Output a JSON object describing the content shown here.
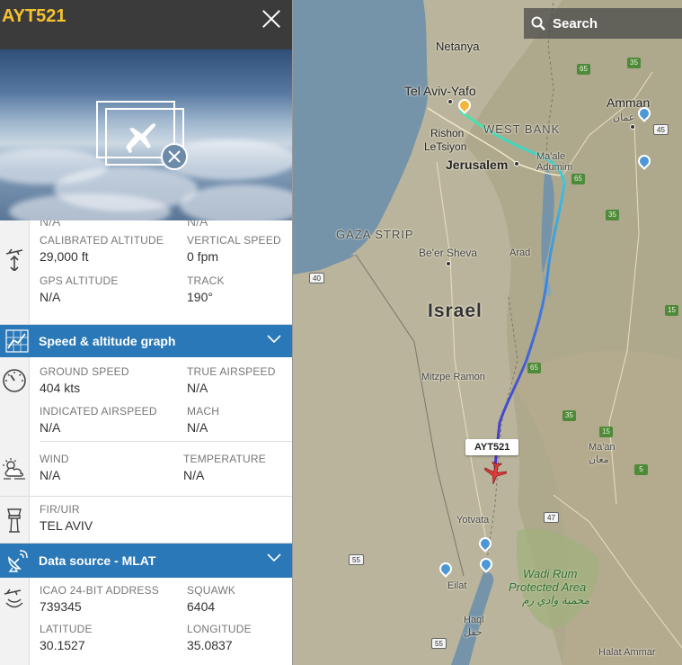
{
  "flight": {
    "callsign": "AYT521"
  },
  "search": {
    "label": "Search"
  },
  "aircraft_section": {
    "clipped_left": "N/A",
    "clipped_right": "N/A",
    "calibrated_altitude": {
      "label": "CALIBRATED ALTITUDE",
      "value": "29,000 ft"
    },
    "vertical_speed": {
      "label": "VERTICAL SPEED",
      "value": "0 fpm"
    },
    "gps_altitude": {
      "label": "GPS ALTITUDE",
      "value": "N/A"
    },
    "track": {
      "label": "TRACK",
      "value": "190°"
    }
  },
  "speed_graph_bar": {
    "label": "Speed & altitude graph"
  },
  "speed_section": {
    "ground_speed": {
      "label": "GROUND SPEED",
      "value": "404 kts"
    },
    "true_airspeed": {
      "label": "TRUE AIRSPEED",
      "value": "N/A"
    },
    "indicated_airspeed": {
      "label": "INDICATED AIRSPEED",
      "value": "N/A"
    },
    "mach": {
      "label": "MACH",
      "value": "N/A"
    }
  },
  "weather_section": {
    "wind": {
      "label": "WIND",
      "value": "N/A"
    },
    "temperature": {
      "label": "TEMPERATURE",
      "value": "N/A"
    }
  },
  "fir_section": {
    "label": "FIR/UIR",
    "value": "TEL AVIV"
  },
  "data_source_bar": {
    "label": "Data source - MLAT"
  },
  "source_section": {
    "icao": {
      "label": "ICAO 24-BIT ADDRESS",
      "value": "739345"
    },
    "squawk": {
      "label": "SQUAWK",
      "value": "6404"
    },
    "latitude": {
      "label": "LATITUDE",
      "value": "30.1527"
    },
    "longitude": {
      "label": "LONGITUDE",
      "value": "35.0837"
    }
  },
  "map": {
    "flight_tag": "AYT521",
    "labels": {
      "netanya": "Netanya",
      "tel_aviv": "Tel Aviv-Yafo",
      "rishon": "Rishon",
      "letsiyon": "LeTsiyon",
      "west_bank": "WEST BANK",
      "jerusalem": "Jerusalem",
      "maale": "Ma'ale",
      "adumim": "Adumim",
      "amman": "Amman",
      "amman_ar": "عمان",
      "gaza": "GAZA STRIP",
      "beer_sheva": "Be'er Sheva",
      "arad": "Arad",
      "israel": "Israel",
      "mitzpe": "Mitzpe Ramon",
      "maan": "Ma'an",
      "maan_ar": "معان",
      "yotvata": "Yotvata",
      "eilat": "Eilat",
      "wadi_rum": "Wadi Rum",
      "protected_area": "Protected Area",
      "wadi_rum_ar": "محمية وادي رم",
      "haql": "Haql",
      "haql_ar": "حقل",
      "halat_ammar": "Halat Ammar"
    },
    "road_numbers": [
      "65",
      "35",
      "45",
      "65",
      "35",
      "40",
      "15",
      "65",
      "35",
      "15",
      "5",
      "47",
      "55",
      "55"
    ]
  },
  "colors": {
    "header_bg": "#3b3b3b",
    "callsign": "#f7c230",
    "section_bar": "#2a78b8",
    "track_start": "#3fe0b0",
    "track_end": "#4a2fc8",
    "aircraft": "#e23b3b"
  }
}
